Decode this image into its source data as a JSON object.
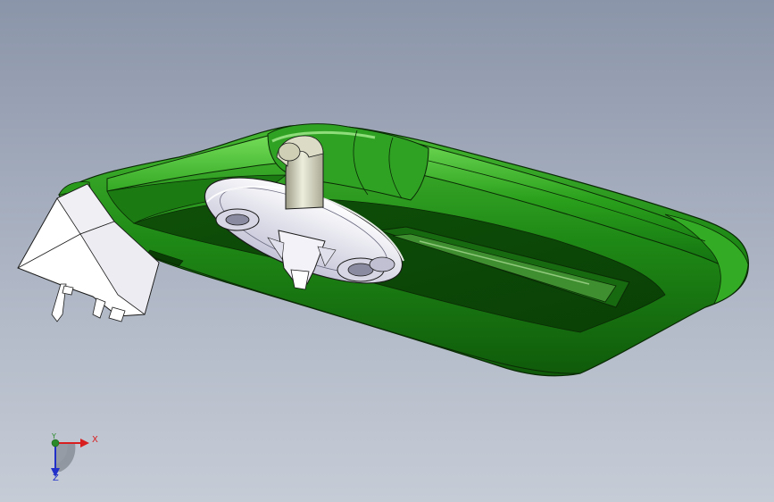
{
  "viewport": {
    "background_top": "#8b95a9",
    "background_bottom": "#c6ccd6"
  },
  "model": {
    "housing_color": "#1f8a16",
    "housing_highlight": "#5fd24a",
    "bracket_color": "#ffffff",
    "hub_color": "#e6e6f4",
    "outline_color": "#0a2a05"
  },
  "triad": {
    "x_label": "X",
    "y_label": "Y",
    "z_label": "Z",
    "x_color": "#d81e1e",
    "y_color": "#2a8a2a",
    "z_color": "#2030c8"
  }
}
